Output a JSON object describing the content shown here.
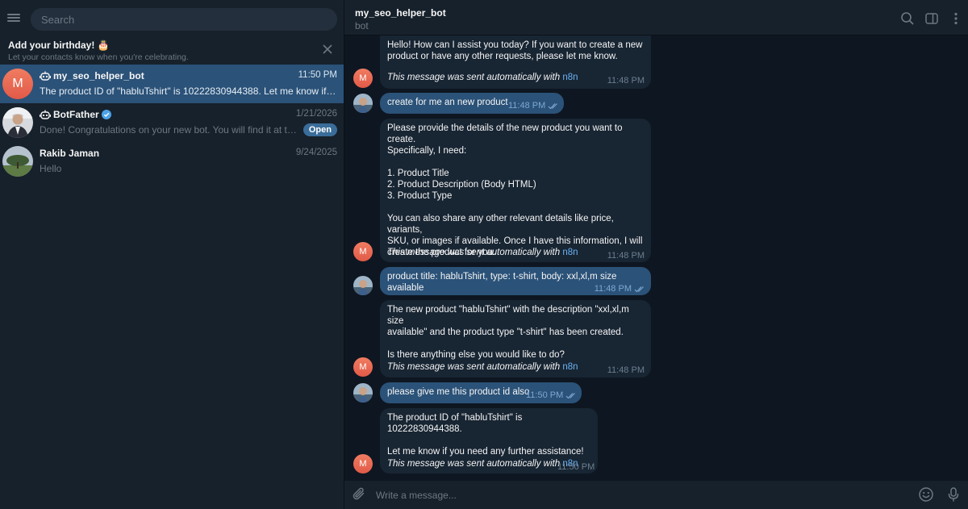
{
  "sidebar": {
    "search_placeholder": "Search",
    "birthday": {
      "title": "Add your birthday! 🎂",
      "subtitle": "Let your contacts know when you're celebrating."
    },
    "chats": [
      {
        "avatar_letter": "M",
        "name": "my_seo_helper_bot",
        "time": "11:50 PM",
        "preview": "The product ID of \"habluTshirt\" is 10222830944388.   Let me know if you nee...",
        "active": true
      },
      {
        "name": "BotFather",
        "time": "1/21/2026",
        "preview": "Done! Congratulations on your new bot. You will find it at t.me/my_s...",
        "badge": "Open",
        "verified": true
      },
      {
        "name": "Rakib Jaman",
        "time": "9/24/2025",
        "preview": "Hello"
      }
    ]
  },
  "header": {
    "title": "my_seo_helper_bot",
    "subtitle": "bot"
  },
  "messages": [
    {
      "direction": "in",
      "text": "Hello! How can I assist you today? If you want to create a new\nproduct or have any other requests, please let me know.",
      "auto_prefix": "This message was sent automatically with ",
      "auto_link": "n8n",
      "time": "11:48 PM"
    },
    {
      "direction": "out",
      "text": "create for me an new product",
      "time": "11:48 PM"
    },
    {
      "direction": "in",
      "text": "Please provide the details of the new product you want to create.\nSpecifically, I need:\n\n1. Product Title\n2. Product Description (Body HTML)\n3. Product Type\n\nYou can also share any other relevant details like price, variants,\nSKU, or images if available. Once I have this information, I will\ncreate the product for you.",
      "auto_prefix": "This message was sent automatically with ",
      "auto_link": "n8n",
      "time": "11:48 PM"
    },
    {
      "direction": "out",
      "text": "product title: habluTshirt, type: t-shirt, body: xxl,xl,m size available",
      "time": "11:48 PM"
    },
    {
      "direction": "in",
      "text": "The new product \"habluTshirt\" with the description \"xxl,xl,m size\navailable\" and the product type \"t-shirt\" has been created.\n\nIs there anything else you would like to do?",
      "auto_prefix": "This message was sent automatically with ",
      "auto_link": "n8n",
      "time": "11:48 PM"
    },
    {
      "direction": "out",
      "text": "please give me this product id also",
      "time": "11:50 PM"
    },
    {
      "direction": "in",
      "text": "The product ID of \"habluTshirt\" is 10222830944388.\n\nLet me know if you need any further assistance!",
      "auto_prefix": "This message was sent automatically with ",
      "auto_link": "n8n",
      "time": "11:50 PM"
    }
  ],
  "composer": {
    "placeholder": "Write a message..."
  },
  "colors": {
    "background": "#0e1621",
    "sidebar": "#17212b",
    "active_chat": "#2b5278",
    "incoming_bubble": "#182533",
    "outgoing_bubble": "#2b5278",
    "link": "#6ab2f2",
    "avatar_m": "#e9684f"
  },
  "icons": {
    "menu": "hamburger-icon",
    "close": "close-icon",
    "bot": "bot-icon",
    "verified": "verified-icon",
    "search": "search-icon",
    "sidebar_toggle": "sidebar-toggle-icon",
    "more": "more-vertical-icon",
    "attach": "paperclip-icon",
    "emoji": "emoji-icon",
    "mic": "microphone-icon",
    "read": "double-check-icon"
  }
}
